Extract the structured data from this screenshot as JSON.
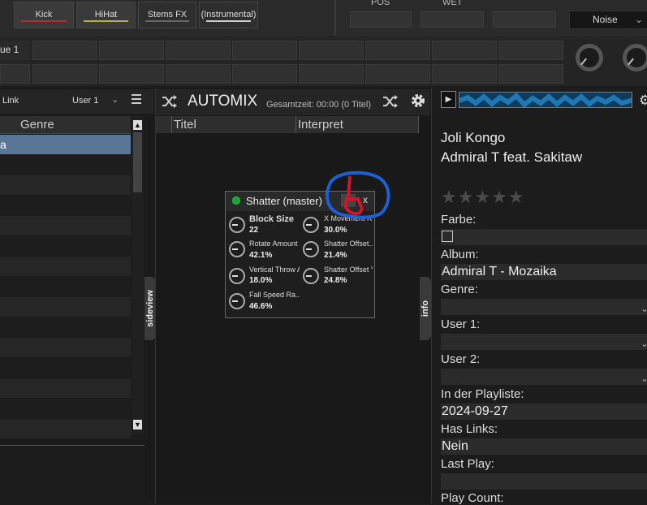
{
  "top_bar": {
    "stems": [
      "Kick",
      "HiHat",
      "Stems FX",
      "(Instrumental)"
    ],
    "stem_colors": [
      "#c0392b",
      "#b5b52a",
      "#666666",
      "#cccccc"
    ],
    "labels": {
      "pos": "POS",
      "wet": "WET"
    },
    "noise_select": "Noise"
  },
  "pads": {
    "first_label": "ue 1"
  },
  "browser": {
    "link_label": "Link",
    "user_select": "User 1",
    "genre_header": "Genre",
    "selected_row_text": "a",
    "menu_icon": "hamburger-icon"
  },
  "sideview_tab": "sideview",
  "automix": {
    "title": "AUTOMIX",
    "subtitle": "Gesamtzeit: 00:00 (0 Titel)",
    "columns": [
      "Titel",
      "Interpret"
    ],
    "icons": [
      "shuffle-icon",
      "shuffle-icon",
      "gear-icon"
    ]
  },
  "info_tab": "info",
  "shatter": {
    "title": "Shatter (master)",
    "pin_icon": "pin-icon",
    "close": "x",
    "params": [
      {
        "name": "Block Size",
        "value": "22"
      },
      {
        "name": "X Movement Ra...",
        "value": "30.0%"
      },
      {
        "name": "Rotate Amount",
        "value": "42.1%"
      },
      {
        "name": "Shatter Offset...",
        "value": "21.4%"
      },
      {
        "name": "Vertical Throw A...",
        "value": "18.0%"
      },
      {
        "name": "Shatter Offset Y...",
        "value": "24.8%"
      },
      {
        "name": "Fall Speed Ra...",
        "value": "46.6%"
      }
    ]
  },
  "info": {
    "title": "Joli Kongo",
    "artist": "Admiral T feat. Sakitaw",
    "rating_stars": 0,
    "fields": {
      "farbe_label": "Farbe:",
      "album_label": "Album:",
      "album_value": "Admiral T - Mozaika",
      "genre_label": "Genre:",
      "genre_value": "",
      "user1_label": "User 1:",
      "user1_value": "",
      "user2_label": "User 2:",
      "user2_value": "",
      "playlist_label": "In der Playliste:",
      "playlist_value": "2024-09-27",
      "haslinks_label": "Has Links:",
      "haslinks_value": "Nein",
      "lastplay_label": "Last Play:",
      "lastplay_value": "",
      "playcount_label": "Play Count:"
    }
  }
}
